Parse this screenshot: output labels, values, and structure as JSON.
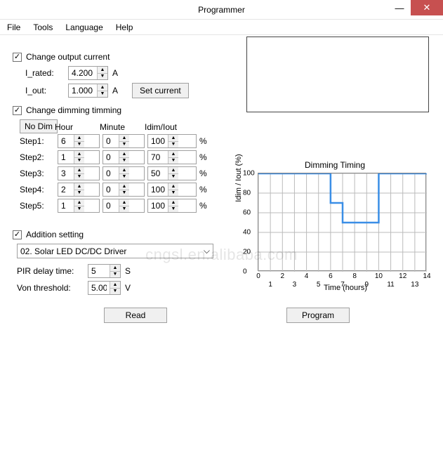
{
  "window": {
    "title": "Programmer"
  },
  "menu": {
    "file": "File",
    "tools": "Tools",
    "language": "Language",
    "help": "Help"
  },
  "output": {
    "change_label": "Change output current",
    "irated_label": "I_rated:",
    "irated_value": "4.200",
    "irated_unit": "A",
    "iout_label": "I_out:",
    "iout_value": "1.000",
    "iout_unit": "A",
    "set_btn": "Set current"
  },
  "dimming": {
    "change_label": "Change dimming timming",
    "nodim_btn": "No Dim",
    "col_hour": "Hour",
    "col_minute": "Minute",
    "col_idim": "Idim/Iout",
    "percent": "%",
    "steps": [
      {
        "label": "Step1:",
        "hour": "6",
        "minute": "0",
        "pct": "100"
      },
      {
        "label": "Step2:",
        "hour": "1",
        "minute": "0",
        "pct": "70"
      },
      {
        "label": "Step3:",
        "hour": "3",
        "minute": "0",
        "pct": "50"
      },
      {
        "label": "Step4:",
        "hour": "2",
        "minute": "0",
        "pct": "100"
      },
      {
        "label": "Step5:",
        "hour": "1",
        "minute": "0",
        "pct": "100"
      }
    ]
  },
  "chart_data": {
    "type": "line",
    "title": "Dimming Timing",
    "xlabel": "Time (hours)",
    "ylabel": "Idim / Iout (%)",
    "xlim": [
      0,
      14
    ],
    "ylim": [
      0,
      100
    ],
    "x": [
      0,
      6,
      6,
      7,
      7,
      10,
      10,
      12,
      12,
      13,
      13,
      14
    ],
    "values": [
      100,
      100,
      70,
      70,
      50,
      50,
      100,
      100,
      100,
      100,
      100,
      100
    ],
    "xticks": [
      0,
      1,
      2,
      3,
      4,
      5,
      6,
      7,
      8,
      9,
      10,
      11,
      12,
      13,
      14
    ],
    "yticks": [
      0,
      20,
      40,
      60,
      80,
      100
    ]
  },
  "addition": {
    "label": "Addition setting",
    "driver_sel": "02. Solar LED DC/DC Driver",
    "pir_label": "PIR delay time:",
    "pir_value": "5",
    "pir_unit": "S",
    "von_label": "Von threshold:",
    "von_value": "5.00",
    "von_unit": "V"
  },
  "buttons": {
    "read": "Read",
    "program": "Program"
  },
  "watermark": "cngsl.en.alibaba.com"
}
